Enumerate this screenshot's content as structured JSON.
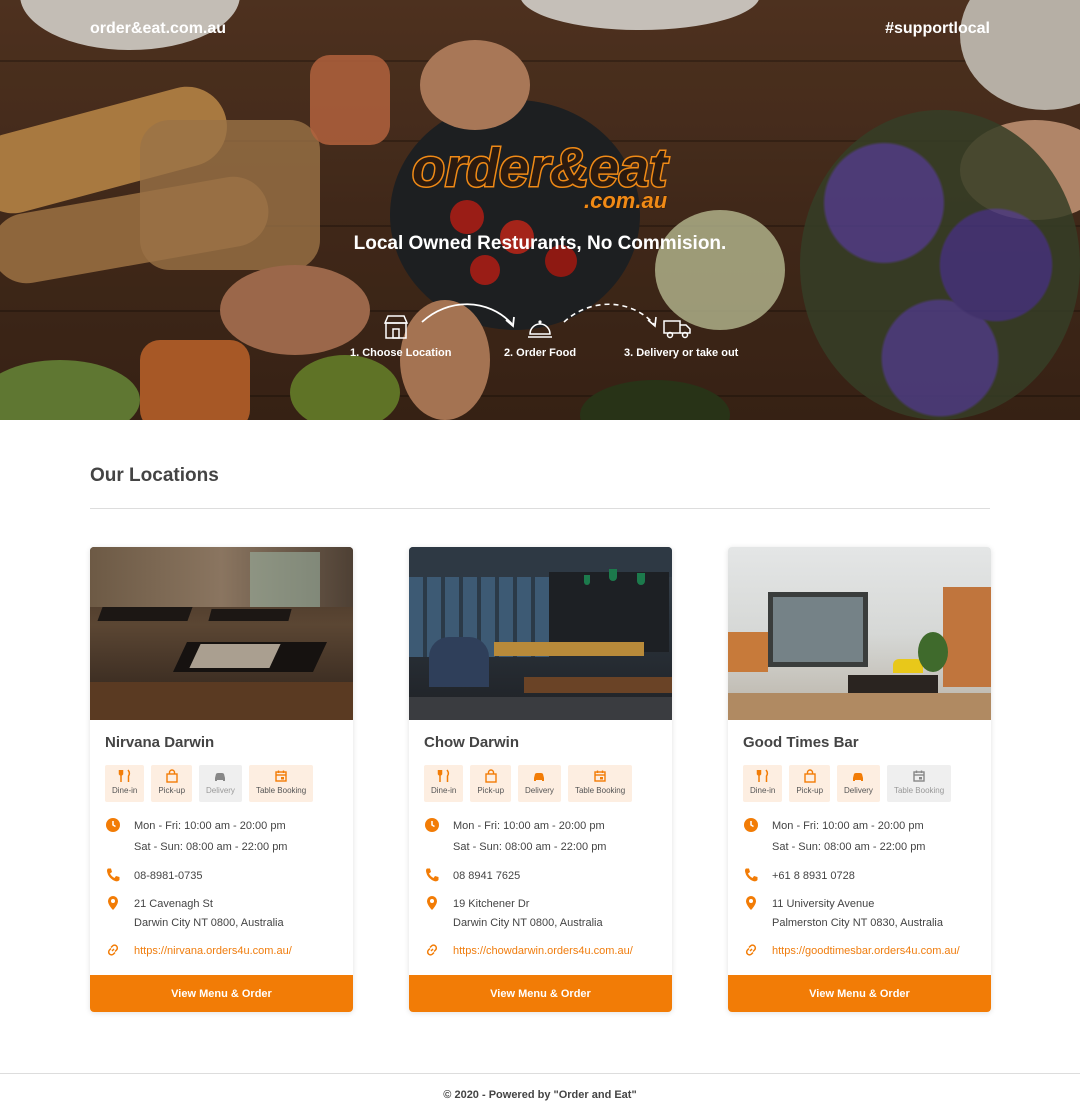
{
  "header": {
    "site_name": "order&eat.com.au",
    "hashtag": "#supportlocal"
  },
  "hero": {
    "logo_text_main": "order&eat",
    "logo_text_domain": ".com.au",
    "tagline": "Local Owned Resturants, No Commision.",
    "steps": [
      {
        "label": "1. Choose Location",
        "icon": "storefront-icon"
      },
      {
        "label": "2. Order Food",
        "icon": "cloche-icon"
      },
      {
        "label": "3. Delivery or take out",
        "icon": "delivery-truck-icon"
      }
    ]
  },
  "locations_section": {
    "title": "Our Locations"
  },
  "colors": {
    "accent": "#f27c06",
    "service_active_bg": "#fdeee1",
    "service_inactive_bg": "#efefef"
  },
  "locations": [
    {
      "name": "Nirvana Darwin",
      "services": [
        {
          "label": "Dine-in",
          "icon": "fork-knife-icon",
          "active": true
        },
        {
          "label": "Pick-up",
          "icon": "shopping-bag-icon",
          "active": true
        },
        {
          "label": "Delivery",
          "icon": "car-icon",
          "active": false
        },
        {
          "label": "Table Booking",
          "icon": "calendar-icon",
          "active": true
        }
      ],
      "hours_weekday": "Mon - Fri: 10:00 am - 20:00 pm",
      "hours_weekend": "Sat - Sun: 08:00 am - 22:00 pm",
      "phone": "08-8981-0735",
      "address_line1": "21 Cavenagh St",
      "address_line2": "Darwin City NT 0800, Australia",
      "url": "https://nirvana.orders4u.com.au/",
      "button": "View Menu & Order"
    },
    {
      "name": "Chow Darwin",
      "services": [
        {
          "label": "Dine-in",
          "icon": "fork-knife-icon",
          "active": true
        },
        {
          "label": "Pick-up",
          "icon": "shopping-bag-icon",
          "active": true
        },
        {
          "label": "Delivery",
          "icon": "car-icon",
          "active": true
        },
        {
          "label": "Table Booking",
          "icon": "calendar-icon",
          "active": true
        }
      ],
      "hours_weekday": "Mon - Fri: 10:00 am - 20:00 pm",
      "hours_weekend": "Sat - Sun: 08:00 am - 22:00 pm",
      "phone": "08 8941 7625",
      "address_line1": "19 Kitchener Dr",
      "address_line2": "Darwin City NT 0800, Australia",
      "url": "https://chowdarwin.orders4u.com.au/",
      "button": "View Menu & Order"
    },
    {
      "name": "Good Times Bar",
      "services": [
        {
          "label": "Dine-in",
          "icon": "fork-knife-icon",
          "active": true
        },
        {
          "label": "Pick-up",
          "icon": "shopping-bag-icon",
          "active": true
        },
        {
          "label": "Delivery",
          "icon": "car-icon",
          "active": true
        },
        {
          "label": "Table Booking",
          "icon": "calendar-icon",
          "active": false
        }
      ],
      "hours_weekday": "Mon - Fri: 10:00 am - 20:00 pm",
      "hours_weekend": "Sat - Sun: 08:00 am - 22:00 pm",
      "phone": "+61 8 8931 0728",
      "address_line1": "11 University Avenue",
      "address_line2": "Palmerston City NT 0830, Australia",
      "url": "https://goodtimesbar.orders4u.com.au/",
      "button": "View Menu & Order"
    }
  ],
  "footer": {
    "text": "© 2020 - Powered by \"Order and Eat\""
  }
}
